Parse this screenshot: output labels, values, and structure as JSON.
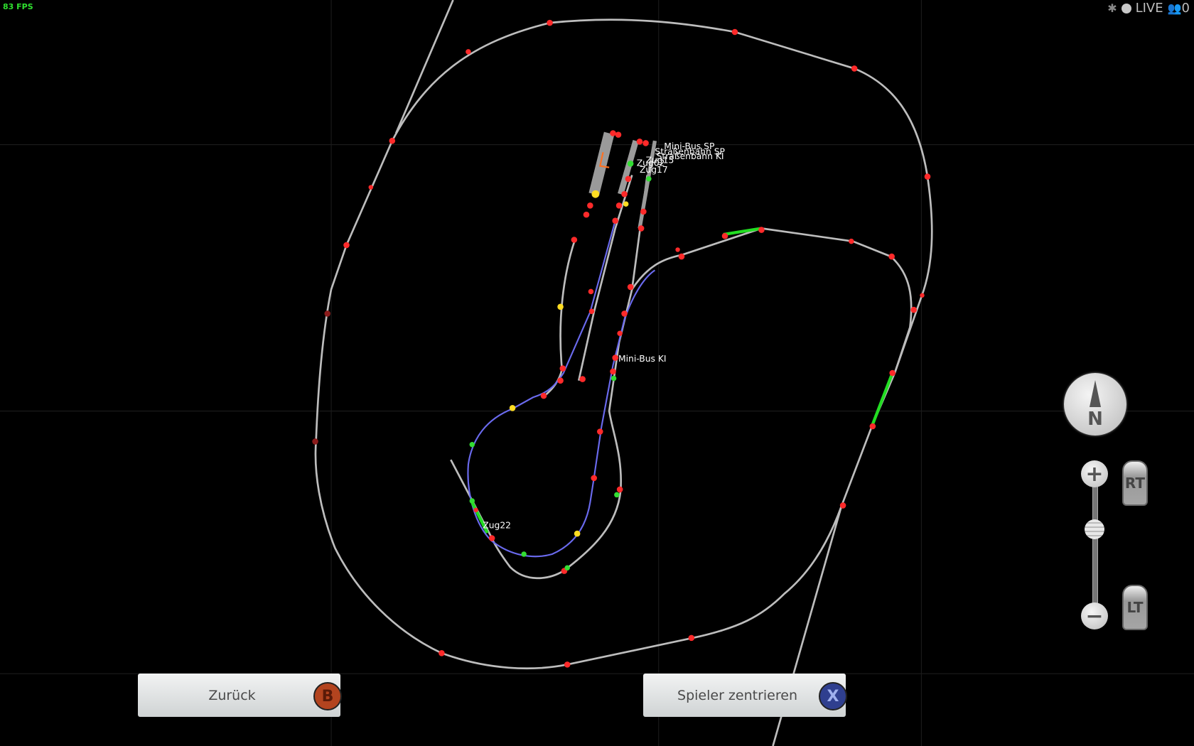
{
  "hud": {
    "fps": "83 FPS",
    "live_label": "LIVE",
    "players_count": "0"
  },
  "map_labels": [
    "Mini-Bus SP",
    "Straßenbahn SP",
    "Straßenbahn KI",
    "Zug15",
    "Zug02",
    "Zug17",
    "Mini-Bus KI",
    "Zug22"
  ],
  "controls": {
    "compass_label": "N",
    "zoom_in": "+",
    "zoom_out": "−",
    "rt_label": "RT",
    "lt_label": "LT",
    "zoom_level": 0.6
  },
  "buttons": {
    "back": {
      "label": "Zurück",
      "key": "B",
      "key_color": "#b3441f"
    },
    "center": {
      "label": "Spieler zentrieren",
      "key": "X",
      "key_color": "#2f3f8f"
    }
  },
  "colors": {
    "track": "#bdbdbd",
    "route": "#6666ee",
    "active": "#22dd22",
    "signal": "#ff2a2a"
  }
}
